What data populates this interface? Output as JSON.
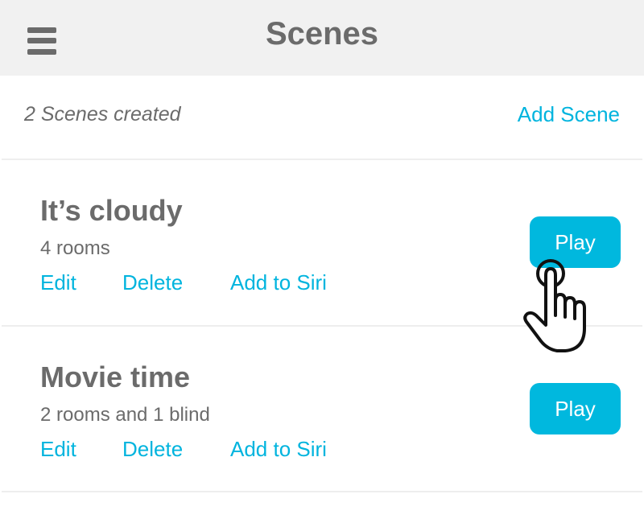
{
  "header": {
    "title": "Scenes",
    "menu_icon": "hamburger-menu-icon"
  },
  "summary": {
    "count_text": "2 Scenes created",
    "add_scene_label": "Add Scene"
  },
  "scenes": [
    {
      "name": "It’s cloudy",
      "description": "4 rooms",
      "actions": {
        "edit": "Edit",
        "delete": "Delete",
        "siri": "Add to Siri"
      },
      "play_label": "Play"
    },
    {
      "name": "Movie time",
      "description": "2 rooms and 1 blind",
      "actions": {
        "edit": "Edit",
        "delete": "Delete",
        "siri": "Add to Siri"
      },
      "play_label": "Play"
    }
  ],
  "cursor": {
    "icon": "hand-pointer-icon"
  },
  "colors": {
    "accent": "#00b4de",
    "button_bg": "#00b8de",
    "text": "#6b6b6b",
    "header_bg": "#f1f1f1",
    "divider": "#eeeeee"
  }
}
